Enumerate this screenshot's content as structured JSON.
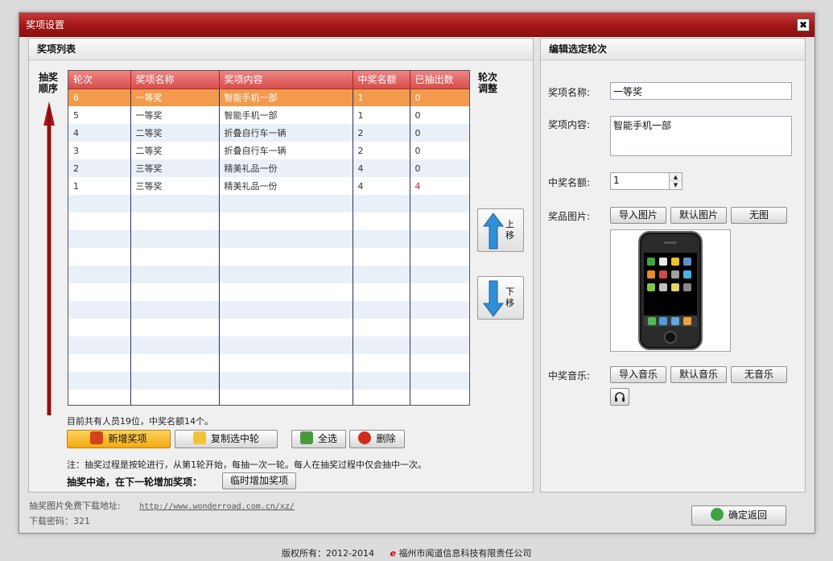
{
  "window": {
    "title": "奖项设置",
    "close_glyph": "✖"
  },
  "left_panel": {
    "title": "奖项列表",
    "order_label": "抽奖顺序",
    "adjust_label": "轮次调整",
    "columns": [
      "轮次",
      "奖项名称",
      "奖项内容",
      "中奖名额",
      "已抽出数"
    ],
    "rows": [
      [
        "6",
        "一等奖",
        "智能手机一部",
        "1",
        "0"
      ],
      [
        "5",
        "一等奖",
        "智能手机一部",
        "1",
        "0"
      ],
      [
        "4",
        "二等奖",
        "折叠自行车一辆",
        "2",
        "0"
      ],
      [
        "3",
        "二等奖",
        "折叠自行车一辆",
        "2",
        "0"
      ],
      [
        "2",
        "三等奖",
        "精美礼品一份",
        "4",
        "0"
      ],
      [
        "1",
        "三等奖",
        "精美礼品一份",
        "4",
        "4"
      ]
    ],
    "empty_rows": 12,
    "move_up": "上移",
    "move_down": "下移",
    "status": "目前共有人员19位，中奖名额14个。",
    "buttons": {
      "add": "新增奖项",
      "copy": "复制选中轮",
      "select_all": "全选",
      "delete": "删除"
    },
    "note": "注：抽奖过程是按轮进行，从第1轮开始，每抽一次一轮。每人在抽奖过程中仅会抽中一次。",
    "midway_label": "抽奖中途，在下一轮增加奖项：",
    "temp_add": "临时增加奖项"
  },
  "right_panel": {
    "title": "编辑选定轮次",
    "name_label": "奖项名称:",
    "name_value": "一等奖",
    "content_label": "奖项内容:",
    "content_value": "智能手机一部",
    "quota_label": "中奖名额:",
    "quota_value": "1",
    "image_label": "奖品图片:",
    "import_image": "导入图片",
    "default_image": "默认图片",
    "no_image": "无图",
    "music_label": "中奖音乐:",
    "import_music": "导入音乐",
    "default_music": "默认音乐",
    "no_music": "无音乐"
  },
  "footer": {
    "download_label": "抽奖图片免费下载地址:",
    "download_url": "http://www.wonderroad.com.cn/xz/",
    "password": "下载密码：321",
    "confirm": "确定返回"
  },
  "copyright": {
    "text": "版权所有：2012-2014",
    "company": "福州市闻道信息科技有限责任公司"
  },
  "colors": {
    "title_red": "#a01515",
    "header_red": "#d84d4d",
    "selected_orange": "#f39a4c",
    "arrow_blue": "#2f8fd8"
  }
}
